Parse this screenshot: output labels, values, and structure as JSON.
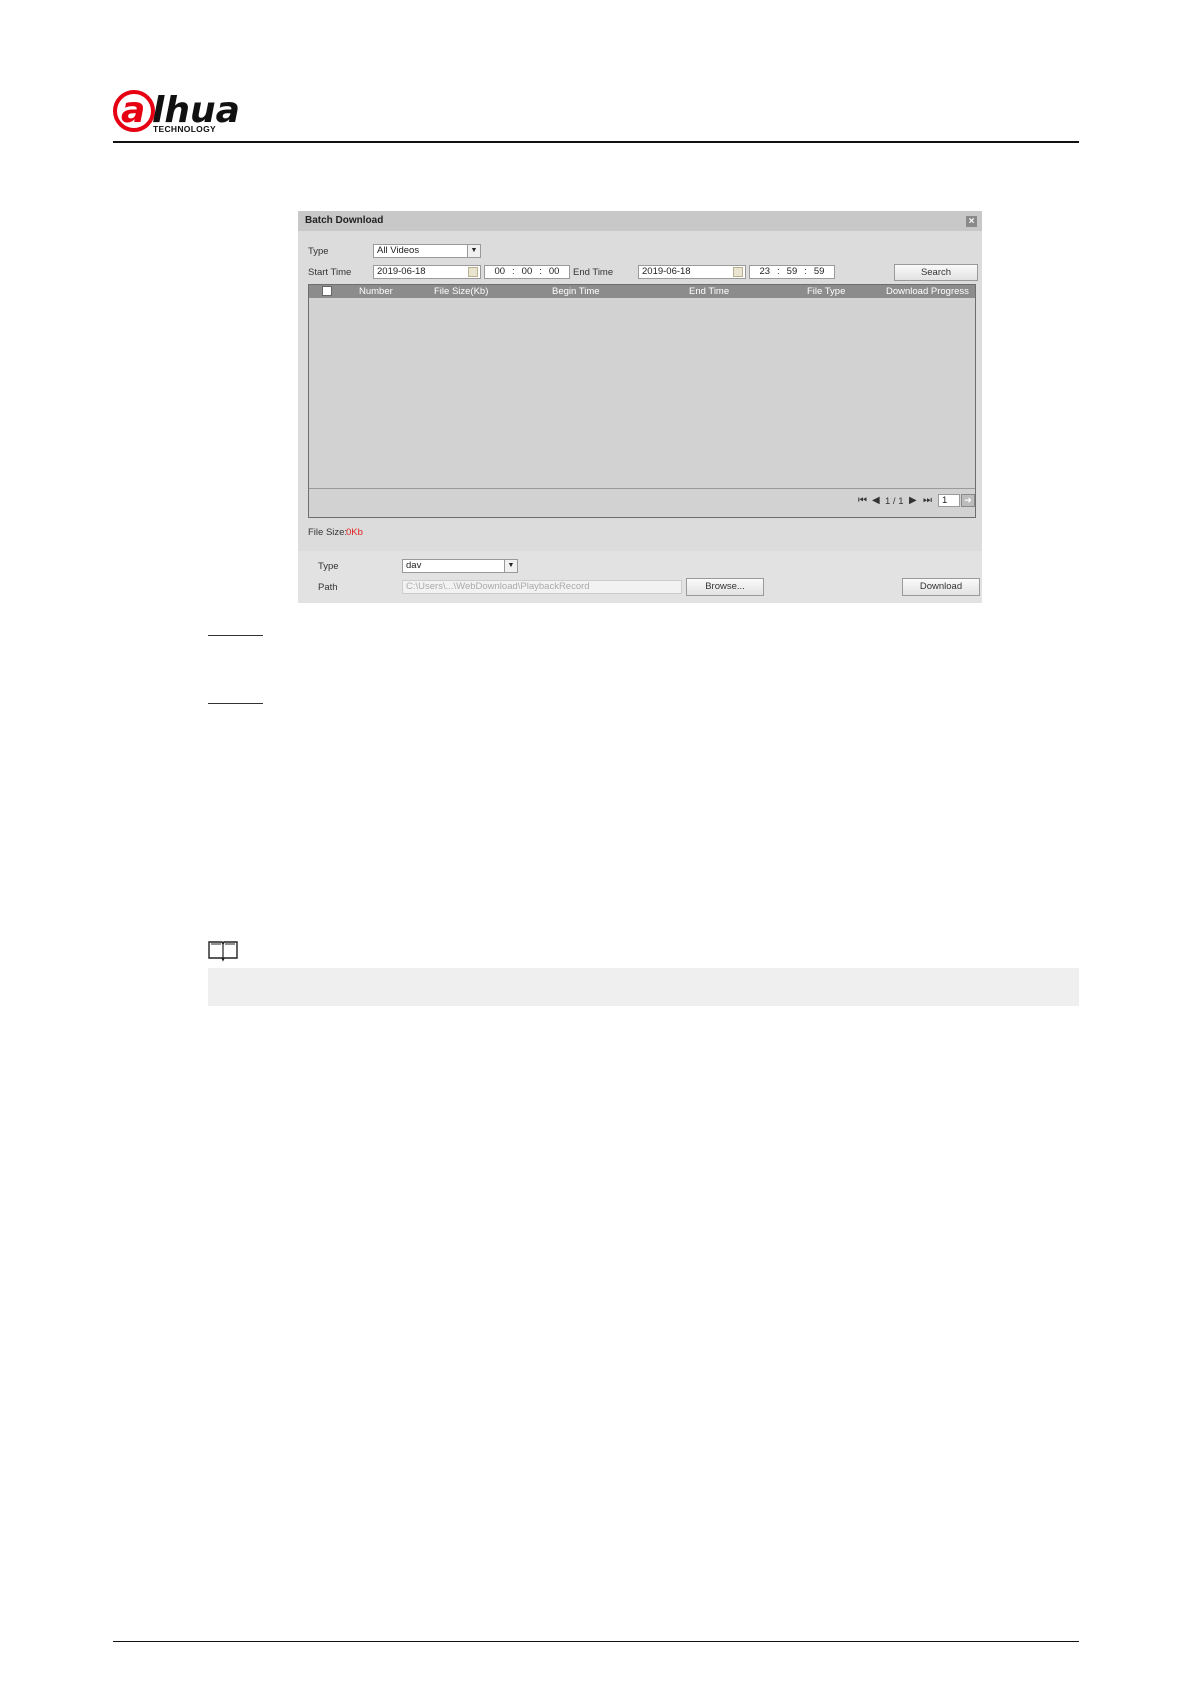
{
  "brand": {
    "logo_text": "alhua",
    "tagline": "TECHNOLOGY",
    "red": "#e60012"
  },
  "dialog": {
    "title": "Batch Download",
    "close_icon": "close-icon",
    "type_label": "Type",
    "type_value": "All Videos",
    "start_time_label": "Start Time",
    "start_date": "2019-06-18",
    "start_hh": "00",
    "start_mm": "00",
    "start_ss": "00",
    "end_time_label": "End Time",
    "end_date": "2019-06-18",
    "end_hh": "23",
    "end_mm": "59",
    "end_ss": "59",
    "time_separator": ":",
    "search_label": "Search",
    "table": {
      "columns": [
        "Number",
        "File Size(Kb)",
        "Begin Time",
        "End Time",
        "File Type",
        "Download Progress"
      ],
      "rows": []
    },
    "pager": {
      "page_info": "1 / 1",
      "page_input": "1"
    },
    "file_size_label": "File Size:",
    "file_size_value": "0Kb",
    "file_size_color": "#e02020",
    "format_label": "Type",
    "format_value": "dav",
    "path_label": "Path",
    "path_value": "C:\\Users\\...\\WebDownload\\PlaybackRecord",
    "browse_label": "Browse...",
    "download_label": "Download"
  }
}
